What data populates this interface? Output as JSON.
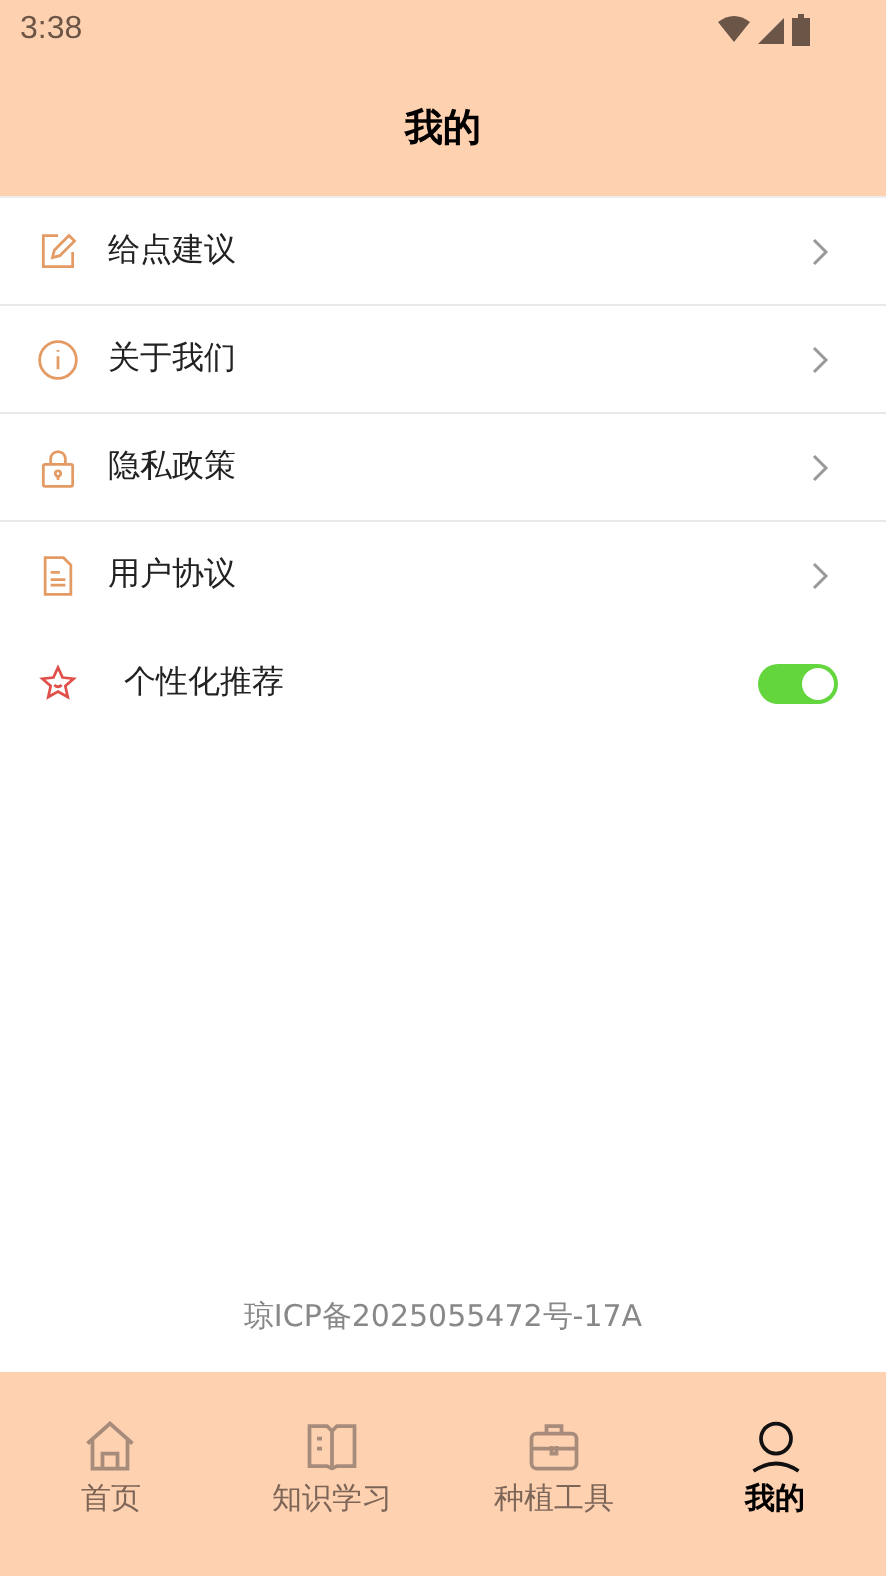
{
  "status_bar": {
    "time": "3:38"
  },
  "header": {
    "title": "我的"
  },
  "menu": [
    {
      "kind": "link",
      "label": "给点建议"
    },
    {
      "kind": "link",
      "label": "关于我们"
    },
    {
      "kind": "link",
      "label": "隐私政策"
    },
    {
      "kind": "link",
      "label": "用户协议"
    },
    {
      "kind": "toggle",
      "label": "个性化推荐",
      "on": true
    }
  ],
  "footer": {
    "icp": "琼ICP备2025055472号-17A"
  },
  "bottom_nav": [
    {
      "label": "首页",
      "selected": false
    },
    {
      "label": "知识学习",
      "selected": false
    },
    {
      "label": "种植工具",
      "selected": false
    },
    {
      "label": "我的",
      "selected": true
    }
  ]
}
